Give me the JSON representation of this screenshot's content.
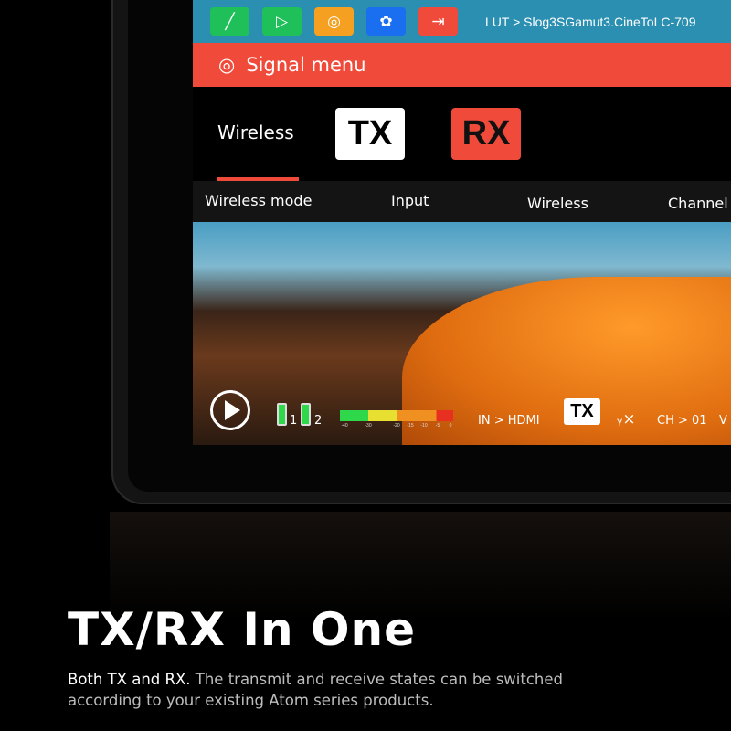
{
  "topbar": {
    "icons": [
      {
        "name": "chart-icon",
        "color": "#1fbf5a"
      },
      {
        "name": "video-camera-icon",
        "color": "#1fbf5a"
      },
      {
        "name": "focus-icon",
        "color": "#f5a020"
      },
      {
        "name": "palette-icon",
        "color": "#1a6ef0"
      },
      {
        "name": "input-icon",
        "color": "#f04a3a"
      }
    ],
    "lut": "LUT > Slog3SGamut3.CineToLC-709"
  },
  "menu": {
    "title": "Signal menu"
  },
  "tabs": {
    "wireless": "Wireless",
    "tx": "TX",
    "rx": "RX"
  },
  "subtabs": [
    "Wireless mode",
    "Input",
    "Wireless",
    "Channel"
  ],
  "hud": {
    "battery1": "1",
    "battery2": "2",
    "meter_ticks": [
      "-40",
      "-30",
      "-20",
      "-15",
      "-10",
      "-5",
      "0"
    ],
    "input": "IN > HDMI",
    "mode": "TX",
    "channel": "CH > 01",
    "extra": "V"
  },
  "marketing": {
    "title": "TX/RX In One",
    "lead": "Both TX and RX.",
    "body": " The transmit and receive states can be switched according to your existing Atom series products."
  }
}
